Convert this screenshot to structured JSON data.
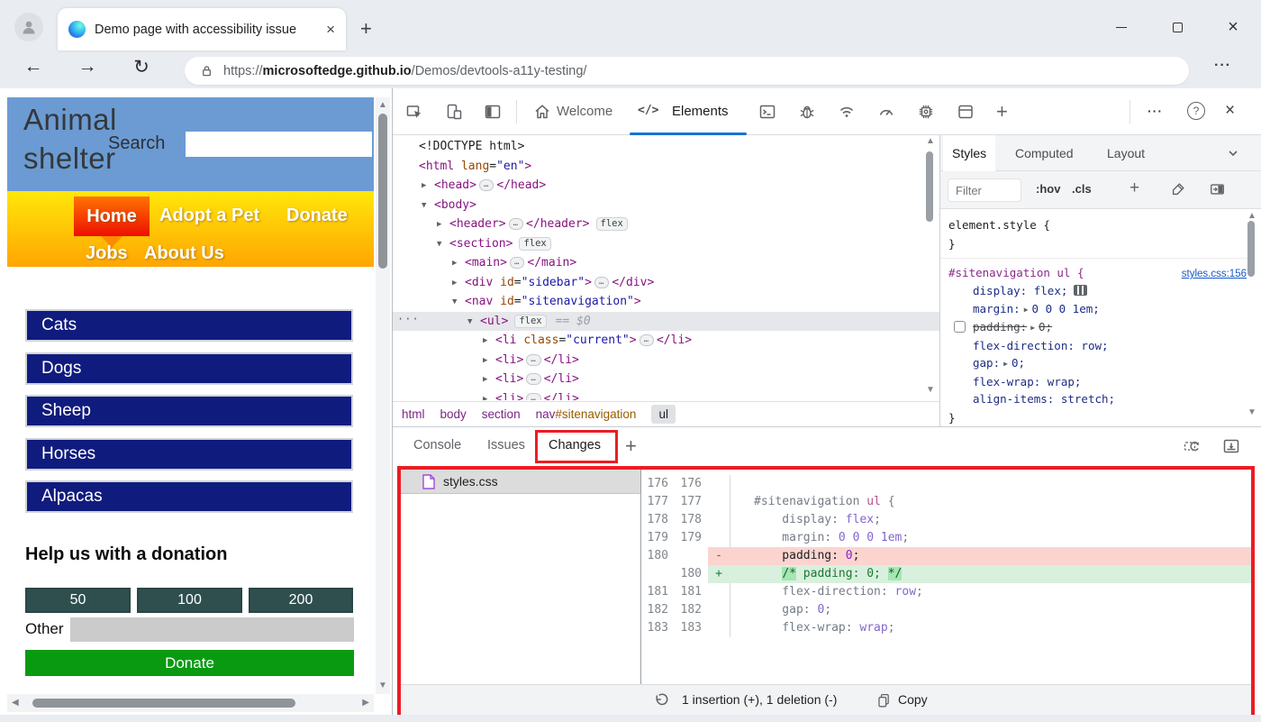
{
  "icons": {
    "back": "←",
    "forward": "→",
    "reload": "↻",
    "more": "···",
    "close": "×",
    "plus": "+",
    "help": "?",
    "dots": "···",
    "row_menu": "···",
    "ellipsis": "…",
    "collapsed_arrow": "▶",
    "expanded_arrow": "▼",
    "scroll_up": "▲",
    "scroll_down": "▼",
    "scroll_left": "◀",
    "scroll_right": "▶",
    "elements_glyph": "</>"
  },
  "colors": {
    "annotation_red": "#ec1c24",
    "active_tab_underline": "#1673d2",
    "site_header_blue": "#6b9bd2",
    "nav_yellow": "#ffe70a",
    "nav_orange": "#ffa502",
    "pet_button_navy": "#101b7e",
    "donate_green": "#0a9a12",
    "amount_teal": "#2f4f4f"
  },
  "browser": {
    "tab_title": "Demo page with accessibility issue",
    "url_scheme": "https://",
    "url_host": "microsoftedge.github.io",
    "url_path": "/Demos/devtools-a11y-testing/"
  },
  "page": {
    "brand_line1": "Animal",
    "brand_line2": "shelter",
    "search_label": "Search",
    "nav_items": [
      "Home",
      "Adopt a Pet",
      "Donate",
      "Jobs",
      "About Us"
    ],
    "sidebar_buttons": [
      "Cats",
      "Dogs",
      "Sheep",
      "Horses",
      "Alpacas"
    ],
    "donation": {
      "heading": "Help us with a donation",
      "amounts": [
        "50",
        "100",
        "200"
      ],
      "other_label": "Other",
      "donate_label": "Donate"
    }
  },
  "devtools": {
    "tabs": {
      "welcome": "Welcome",
      "elements": "Elements"
    },
    "dom_rows": [
      {
        "lvl": 0,
        "arrow": "",
        "tokens": [
          [
            "<!DOCTYPE html>",
            "pln"
          ]
        ]
      },
      {
        "lvl": 0,
        "arrow": "",
        "tokens": [
          [
            "<html ",
            "tag"
          ],
          [
            "lang",
            "attr"
          ],
          [
            "=",
            "pln"
          ],
          [
            "\"en\"",
            "str"
          ],
          [
            ">",
            "tag"
          ]
        ]
      },
      {
        "lvl": 1,
        "arrow": "c",
        "tokens": [
          [
            "<head>",
            "tag"
          ],
          [
            "…",
            "ell"
          ],
          [
            "</head>",
            "tag"
          ]
        ]
      },
      {
        "lvl": 1,
        "arrow": "e",
        "tokens": [
          [
            "<body>",
            "tag"
          ]
        ]
      },
      {
        "lvl": 2,
        "arrow": "c",
        "badge": "flex",
        "tokens": [
          [
            "<header>",
            "tag"
          ],
          [
            "…",
            "ell"
          ],
          [
            "</header>",
            "tag"
          ]
        ]
      },
      {
        "lvl": 2,
        "arrow": "e",
        "badge": "flex",
        "tokens": [
          [
            "<section>",
            "tag"
          ]
        ]
      },
      {
        "lvl": 3,
        "arrow": "c",
        "tokens": [
          [
            "<main>",
            "tag"
          ],
          [
            "…",
            "ell"
          ],
          [
            "</main>",
            "tag"
          ]
        ]
      },
      {
        "lvl": 3,
        "arrow": "c",
        "tokens": [
          [
            "<div ",
            "tag"
          ],
          [
            "id",
            "attr"
          ],
          [
            "=",
            "pln"
          ],
          [
            "\"sidebar\"",
            "str"
          ],
          [
            ">",
            "tag"
          ],
          [
            "…",
            "ell"
          ],
          [
            "</div>",
            "tag"
          ]
        ]
      },
      {
        "lvl": 3,
        "arrow": "e",
        "tokens": [
          [
            "<nav ",
            "tag"
          ],
          [
            "id",
            "attr"
          ],
          [
            "=",
            "pln"
          ],
          [
            "\"sitenavigation\"",
            "str"
          ],
          [
            ">",
            "tag"
          ]
        ]
      },
      {
        "lvl": 4,
        "arrow": "e",
        "sel": true,
        "gutter": true,
        "badge": "flex",
        "suffix": "== $0",
        "tokens": [
          [
            "<ul>",
            "tag"
          ]
        ]
      },
      {
        "lvl": 5,
        "arrow": "c",
        "tokens": [
          [
            "<li ",
            "tag"
          ],
          [
            "class",
            "attr"
          ],
          [
            "=",
            "pln"
          ],
          [
            "\"current\"",
            "str"
          ],
          [
            ">",
            "tag"
          ],
          [
            "…",
            "ell"
          ],
          [
            "</li>",
            "tag"
          ]
        ]
      },
      {
        "lvl": 5,
        "arrow": "c",
        "tokens": [
          [
            "<li>",
            "tag"
          ],
          [
            "…",
            "ell"
          ],
          [
            "</li>",
            "tag"
          ]
        ]
      },
      {
        "lvl": 5,
        "arrow": "c",
        "tokens": [
          [
            "<li>",
            "tag"
          ],
          [
            "…",
            "ell"
          ],
          [
            "</li>",
            "tag"
          ]
        ]
      },
      {
        "lvl": 5,
        "arrow": "c",
        "clip": true,
        "tokens": [
          [
            "<li>",
            "tag"
          ],
          [
            "…",
            "ell"
          ],
          [
            "</li>",
            "tag"
          ]
        ]
      }
    ],
    "breadcrumbs": {
      "tags": [
        "html",
        "body",
        "section"
      ],
      "nav_tag": "nav",
      "nav_id": "#sitenavigation",
      "current": "ul"
    },
    "styles": {
      "tabs": [
        "Styles",
        "Computed",
        "Layout"
      ],
      "filter_placeholder": "Filter",
      "hov": ":hov",
      "cls": ".cls",
      "element_style_open": "element.style {",
      "element_style_close": "}",
      "rule": {
        "selector": "#sitenavigation ul {",
        "link": "styles.css:156",
        "props": [
          {
            "n": "display:",
            "v": "flex;"
          },
          {
            "n": "margin:",
            "v": "0 0 0 1em;"
          },
          {
            "n": "padding:",
            "v": "0;"
          },
          {
            "n": "flex-direction:",
            "v": "row;"
          },
          {
            "n": "gap:",
            "v": "0;"
          },
          {
            "n": "flex-wrap:",
            "v": "wrap;"
          },
          {
            "n": "align-items:",
            "v": "stretch;"
          }
        ],
        "close": "}"
      }
    },
    "drawer": {
      "tabs": [
        "Console",
        "Issues",
        "Changes"
      ],
      "file": "styles.css",
      "diff_rows": [
        {
          "o": "176",
          "n": "176",
          "m": "",
          "k": "",
          "tokens": []
        },
        {
          "o": "177",
          "n": "177",
          "m": "",
          "k": "",
          "tokens": [
            [
              "#sitenavigation ",
              "sel2"
            ],
            [
              "ul",
              "tag2"
            ],
            [
              " {",
              "sel2"
            ]
          ]
        },
        {
          "o": "178",
          "n": "178",
          "m": "",
          "k": "",
          "tokens": [
            [
              "    display: ",
              "prop2"
            ],
            [
              "flex",
              "val2"
            ],
            [
              ";",
              "prop2"
            ]
          ]
        },
        {
          "o": "179",
          "n": "179",
          "m": "",
          "k": "",
          "tokens": [
            [
              "    margin: ",
              "prop2"
            ],
            [
              "0 0 0 1em",
              "val2"
            ],
            [
              ";",
              "prop2"
            ]
          ]
        },
        {
          "o": "180",
          "n": "",
          "m": "-",
          "k": "del",
          "tokens": [
            [
              "    padding: ",
              "deltext"
            ],
            [
              "0",
              "delval"
            ],
            [
              ";",
              "deltext"
            ]
          ]
        },
        {
          "o": "",
          "n": "180",
          "m": "+",
          "k": "add",
          "tokens": [
            [
              "    ",
              "cmt"
            ],
            [
              "/*",
              "cmttok"
            ],
            [
              " padding: 0; ",
              "cmt"
            ],
            [
              "*/",
              "cmttok"
            ]
          ]
        },
        {
          "o": "181",
          "n": "181",
          "m": "",
          "k": "",
          "tokens": [
            [
              "    flex-direction: ",
              "prop2"
            ],
            [
              "row",
              "val2"
            ],
            [
              ";",
              "prop2"
            ]
          ]
        },
        {
          "o": "182",
          "n": "182",
          "m": "",
          "k": "",
          "tokens": [
            [
              "    gap: ",
              "prop2"
            ],
            [
              "0",
              "val2"
            ],
            [
              ";",
              "prop2"
            ]
          ]
        },
        {
          "o": "183",
          "n": "183",
          "m": "",
          "k": "",
          "tokens": [
            [
              "    flex-wrap: ",
              "prop2"
            ],
            [
              "wrap",
              "val2"
            ],
            [
              ";",
              "prop2"
            ]
          ]
        }
      ],
      "status": {
        "summary": "1 insertion (+), 1 deletion (-)",
        "copy_label": "Copy"
      }
    }
  }
}
